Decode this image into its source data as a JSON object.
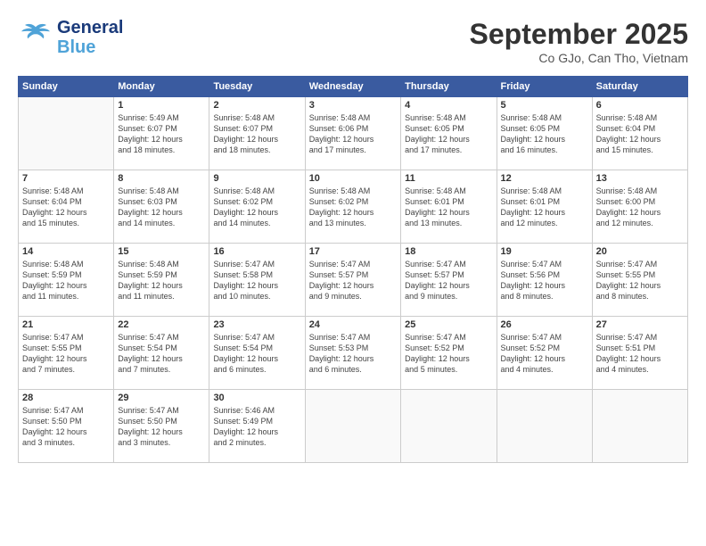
{
  "header": {
    "logo_text_general": "General",
    "logo_text_blue": "Blue",
    "month_title": "September 2025",
    "subtitle": "Co GJo, Can Tho, Vietnam"
  },
  "days_of_week": [
    "Sunday",
    "Monday",
    "Tuesday",
    "Wednesday",
    "Thursday",
    "Friday",
    "Saturday"
  ],
  "weeks": [
    [
      {
        "day": "",
        "info": ""
      },
      {
        "day": "1",
        "info": "Sunrise: 5:49 AM\nSunset: 6:07 PM\nDaylight: 12 hours\nand 18 minutes."
      },
      {
        "day": "2",
        "info": "Sunrise: 5:48 AM\nSunset: 6:07 PM\nDaylight: 12 hours\nand 18 minutes."
      },
      {
        "day": "3",
        "info": "Sunrise: 5:48 AM\nSunset: 6:06 PM\nDaylight: 12 hours\nand 17 minutes."
      },
      {
        "day": "4",
        "info": "Sunrise: 5:48 AM\nSunset: 6:05 PM\nDaylight: 12 hours\nand 17 minutes."
      },
      {
        "day": "5",
        "info": "Sunrise: 5:48 AM\nSunset: 6:05 PM\nDaylight: 12 hours\nand 16 minutes."
      },
      {
        "day": "6",
        "info": "Sunrise: 5:48 AM\nSunset: 6:04 PM\nDaylight: 12 hours\nand 15 minutes."
      }
    ],
    [
      {
        "day": "7",
        "info": "Sunrise: 5:48 AM\nSunset: 6:04 PM\nDaylight: 12 hours\nand 15 minutes."
      },
      {
        "day": "8",
        "info": "Sunrise: 5:48 AM\nSunset: 6:03 PM\nDaylight: 12 hours\nand 14 minutes."
      },
      {
        "day": "9",
        "info": "Sunrise: 5:48 AM\nSunset: 6:02 PM\nDaylight: 12 hours\nand 14 minutes."
      },
      {
        "day": "10",
        "info": "Sunrise: 5:48 AM\nSunset: 6:02 PM\nDaylight: 12 hours\nand 13 minutes."
      },
      {
        "day": "11",
        "info": "Sunrise: 5:48 AM\nSunset: 6:01 PM\nDaylight: 12 hours\nand 13 minutes."
      },
      {
        "day": "12",
        "info": "Sunrise: 5:48 AM\nSunset: 6:01 PM\nDaylight: 12 hours\nand 12 minutes."
      },
      {
        "day": "13",
        "info": "Sunrise: 5:48 AM\nSunset: 6:00 PM\nDaylight: 12 hours\nand 12 minutes."
      }
    ],
    [
      {
        "day": "14",
        "info": "Sunrise: 5:48 AM\nSunset: 5:59 PM\nDaylight: 12 hours\nand 11 minutes."
      },
      {
        "day": "15",
        "info": "Sunrise: 5:48 AM\nSunset: 5:59 PM\nDaylight: 12 hours\nand 11 minutes."
      },
      {
        "day": "16",
        "info": "Sunrise: 5:47 AM\nSunset: 5:58 PM\nDaylight: 12 hours\nand 10 minutes."
      },
      {
        "day": "17",
        "info": "Sunrise: 5:47 AM\nSunset: 5:57 PM\nDaylight: 12 hours\nand 9 minutes."
      },
      {
        "day": "18",
        "info": "Sunrise: 5:47 AM\nSunset: 5:57 PM\nDaylight: 12 hours\nand 9 minutes."
      },
      {
        "day": "19",
        "info": "Sunrise: 5:47 AM\nSunset: 5:56 PM\nDaylight: 12 hours\nand 8 minutes."
      },
      {
        "day": "20",
        "info": "Sunrise: 5:47 AM\nSunset: 5:55 PM\nDaylight: 12 hours\nand 8 minutes."
      }
    ],
    [
      {
        "day": "21",
        "info": "Sunrise: 5:47 AM\nSunset: 5:55 PM\nDaylight: 12 hours\nand 7 minutes."
      },
      {
        "day": "22",
        "info": "Sunrise: 5:47 AM\nSunset: 5:54 PM\nDaylight: 12 hours\nand 7 minutes."
      },
      {
        "day": "23",
        "info": "Sunrise: 5:47 AM\nSunset: 5:54 PM\nDaylight: 12 hours\nand 6 minutes."
      },
      {
        "day": "24",
        "info": "Sunrise: 5:47 AM\nSunset: 5:53 PM\nDaylight: 12 hours\nand 6 minutes."
      },
      {
        "day": "25",
        "info": "Sunrise: 5:47 AM\nSunset: 5:52 PM\nDaylight: 12 hours\nand 5 minutes."
      },
      {
        "day": "26",
        "info": "Sunrise: 5:47 AM\nSunset: 5:52 PM\nDaylight: 12 hours\nand 4 minutes."
      },
      {
        "day": "27",
        "info": "Sunrise: 5:47 AM\nSunset: 5:51 PM\nDaylight: 12 hours\nand 4 minutes."
      }
    ],
    [
      {
        "day": "28",
        "info": "Sunrise: 5:47 AM\nSunset: 5:50 PM\nDaylight: 12 hours\nand 3 minutes."
      },
      {
        "day": "29",
        "info": "Sunrise: 5:47 AM\nSunset: 5:50 PM\nDaylight: 12 hours\nand 3 minutes."
      },
      {
        "day": "30",
        "info": "Sunrise: 5:46 AM\nSunset: 5:49 PM\nDaylight: 12 hours\nand 2 minutes."
      },
      {
        "day": "",
        "info": ""
      },
      {
        "day": "",
        "info": ""
      },
      {
        "day": "",
        "info": ""
      },
      {
        "day": "",
        "info": ""
      }
    ]
  ]
}
